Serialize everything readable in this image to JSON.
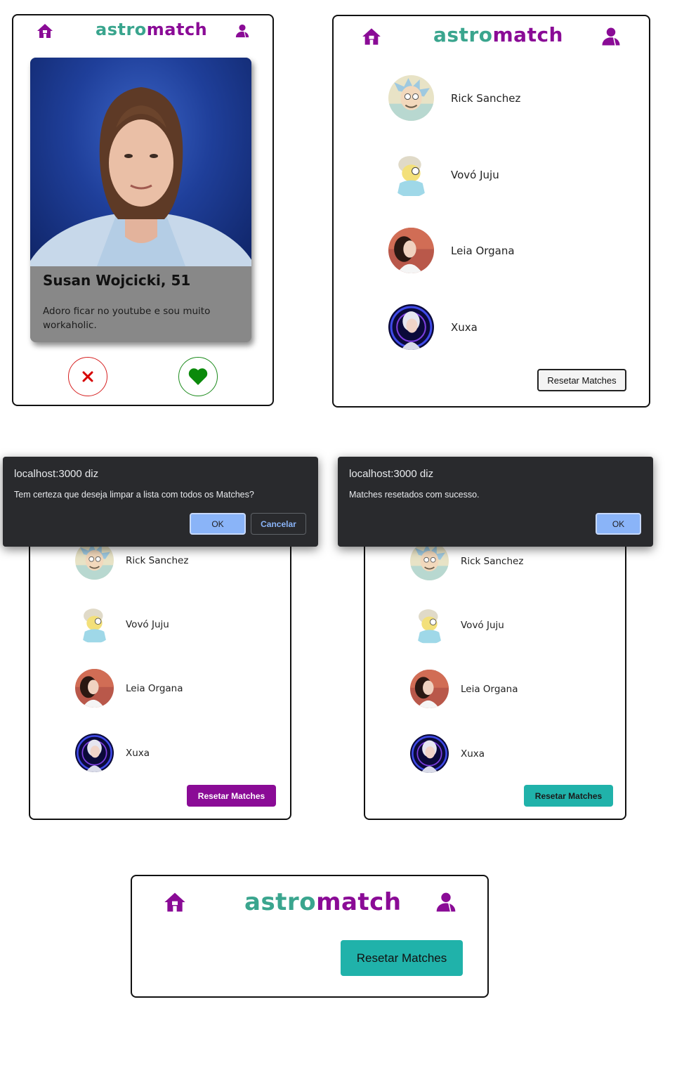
{
  "app": {
    "logo_part1": "astro",
    "logo_part2": "match",
    "accent_purple": "#8a0b96",
    "accent_teal": "#3aa58e",
    "reset_teal": "#20b2aa"
  },
  "profile": {
    "name_age": "Susan Wojcicki, 51",
    "bio": "Adoro ficar no youtube e sou muito workaholic.",
    "reject_icon": "close-icon",
    "like_icon": "heart-icon"
  },
  "matches": [
    {
      "name": "Rick Sanchez"
    },
    {
      "name": "Vovó Juju"
    },
    {
      "name": "Leia Organa"
    },
    {
      "name": "Xuxa"
    }
  ],
  "reset_label": "Resetar Matches",
  "confirm_dialog": {
    "title": "localhost:3000 diz",
    "message": "Tem certeza que deseja limpar a lista com todos os Matches?",
    "ok_label": "OK",
    "cancel_label": "Cancelar"
  },
  "success_dialog": {
    "title": "localhost:3000 diz",
    "message": "Matches resetados com sucesso.",
    "ok_label": "OK"
  }
}
